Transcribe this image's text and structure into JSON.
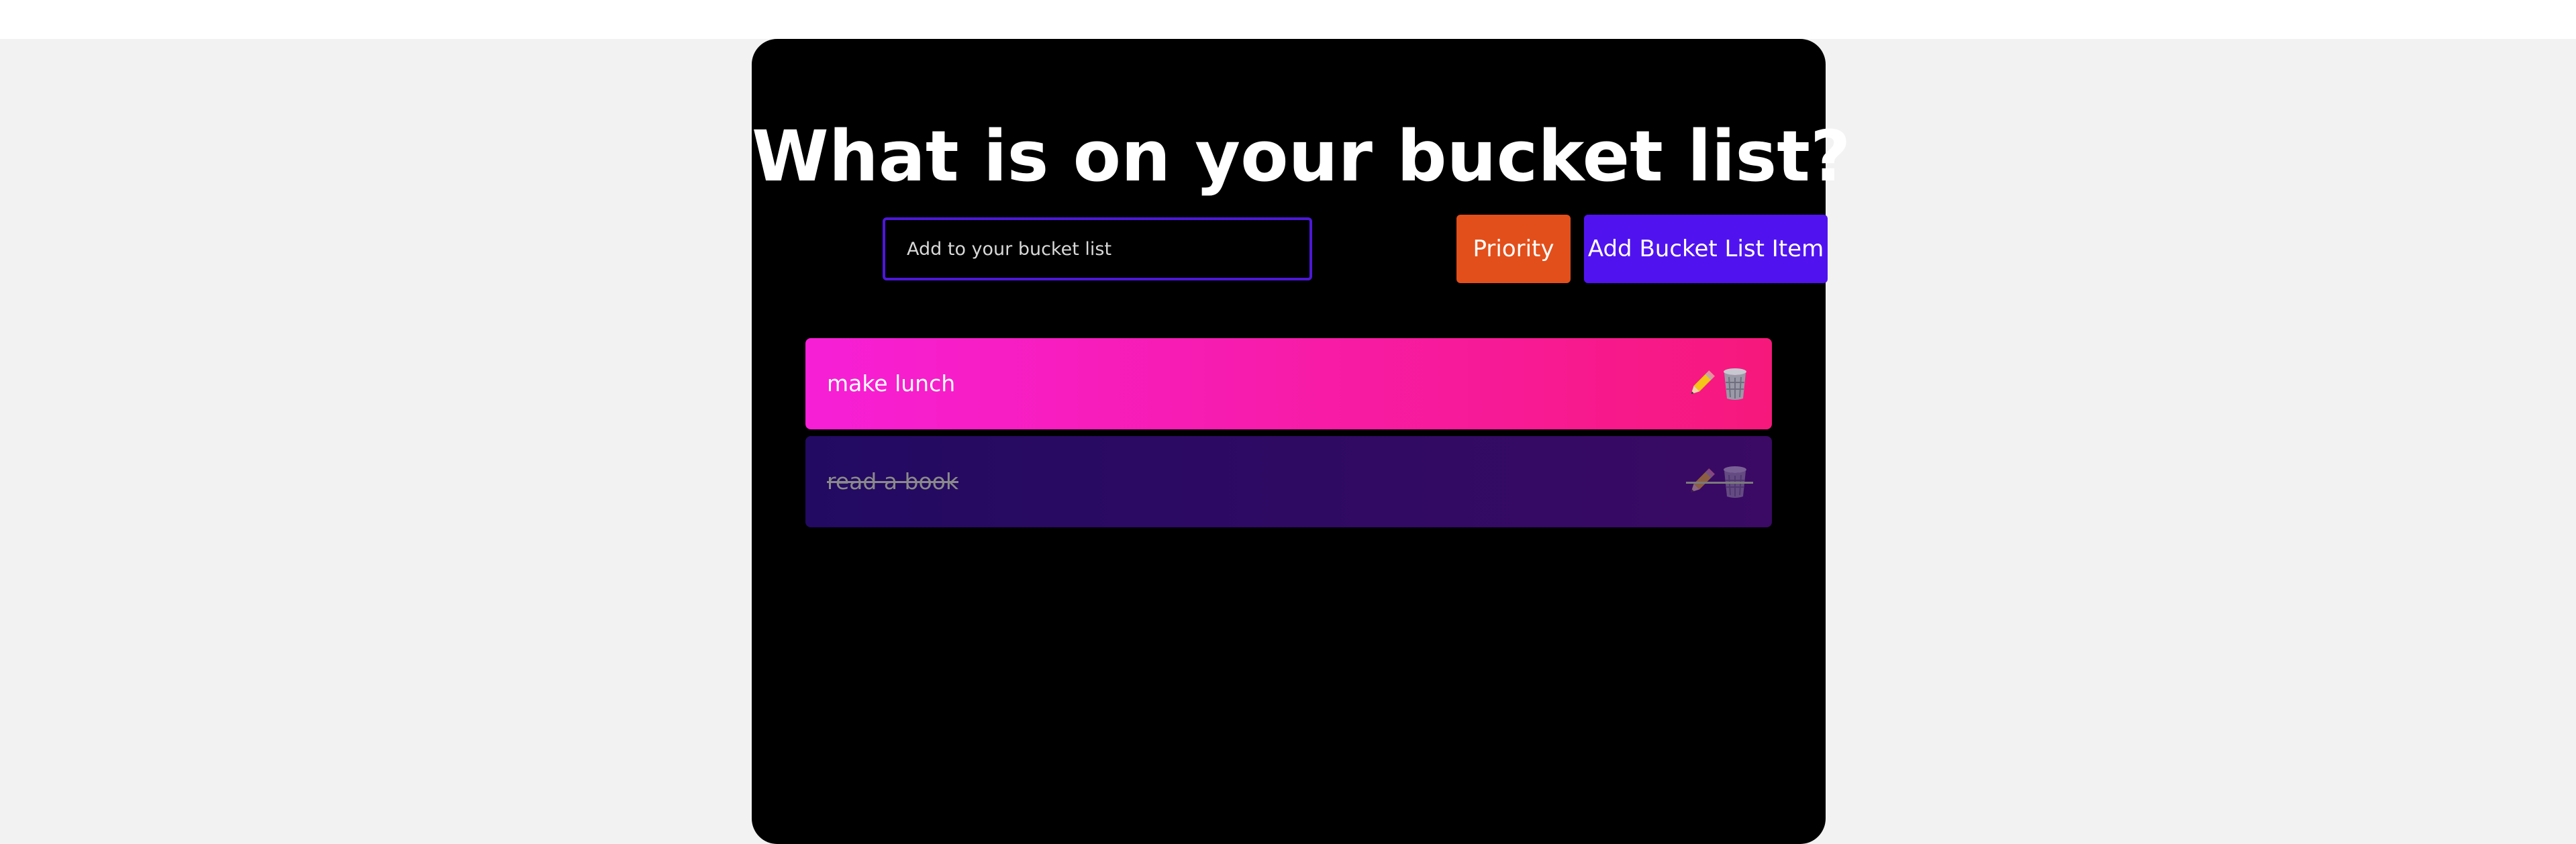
{
  "header": {
    "title": "What is on your bucket list?"
  },
  "form": {
    "input_placeholder": "Add to your bucket list",
    "input_value": "",
    "priority_label": "Priority",
    "add_label": "Add Bucket List Item"
  },
  "items": [
    {
      "label": "make lunch",
      "completed": false,
      "icons": [
        "pencil-icon",
        "wastebasket-icon"
      ]
    },
    {
      "label": "read a book",
      "completed": true,
      "icons": [
        "pencil-icon",
        "wastebasket-icon"
      ]
    }
  ],
  "colors": {
    "page_background": "#f2f2f2",
    "app_background": "#000000",
    "input_border": "#4c18d8",
    "priority_button": "#e24f1b",
    "add_button": "#5013f0",
    "active_item_gradient": [
      "#f71fd7",
      "#f7187c"
    ],
    "completed_item_gradient": [
      "#220a62",
      "#3a0a64"
    ]
  }
}
